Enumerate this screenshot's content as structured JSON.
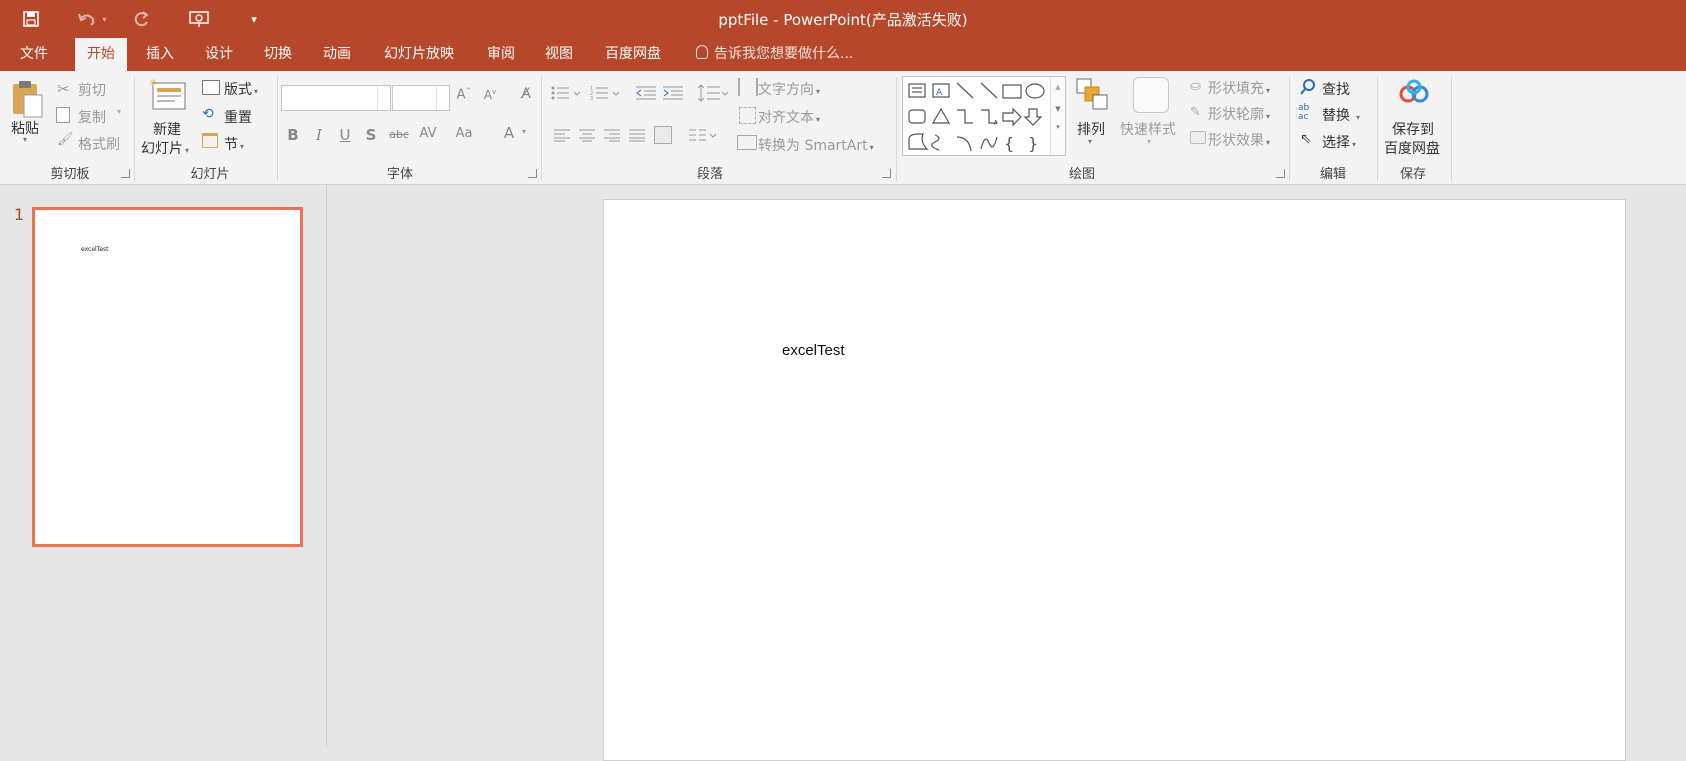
{
  "window": {
    "title": "pptFile - PowerPoint(产品激活失败)"
  },
  "tabs": [
    "文件",
    "开始",
    "插入",
    "设计",
    "切换",
    "动画",
    "幻灯片放映",
    "审阅",
    "视图",
    "百度网盘"
  ],
  "active_tab": "开始",
  "tell_me": "告诉我您想要做什么...",
  "ribbon": {
    "clipboard": {
      "paste": "粘贴",
      "cut": "剪切",
      "copy": "复制",
      "format_painter": "格式刷",
      "label": "剪切板"
    },
    "slides": {
      "new_slide_line1": "新建",
      "new_slide_line2": "幻灯片",
      "layout": "版式",
      "reset": "重置",
      "section": "节",
      "label": "幻灯片"
    },
    "font": {
      "label": "字体",
      "bold": "B",
      "italic": "I",
      "underline": "U",
      "shadow": "S",
      "strike": "abc",
      "spacing": "AV",
      "case": "Aa",
      "color": "A"
    },
    "paragraph": {
      "text_direction": "文字方向",
      "align_text": "对齐文本",
      "smartart": "转换为 SmartArt",
      "label": "段落"
    },
    "drawing": {
      "arrange": "排列",
      "quick_styles": "快速样式",
      "shape_fill": "形状填充",
      "shape_outline": "形状轮廓",
      "shape_effects": "形状效果",
      "label": "绘图"
    },
    "editing": {
      "find": "查找",
      "replace": "替换",
      "select": "选择",
      "label": "编辑"
    },
    "save": {
      "line1": "保存到",
      "line2": "百度网盘",
      "label": "保存"
    }
  },
  "colors": {
    "accent": "#b7472a",
    "thumb_border": "#ec7355"
  },
  "thumbnails": [
    {
      "number": "1",
      "text": "excelTest"
    }
  ],
  "slide": {
    "text": "excelTest"
  }
}
